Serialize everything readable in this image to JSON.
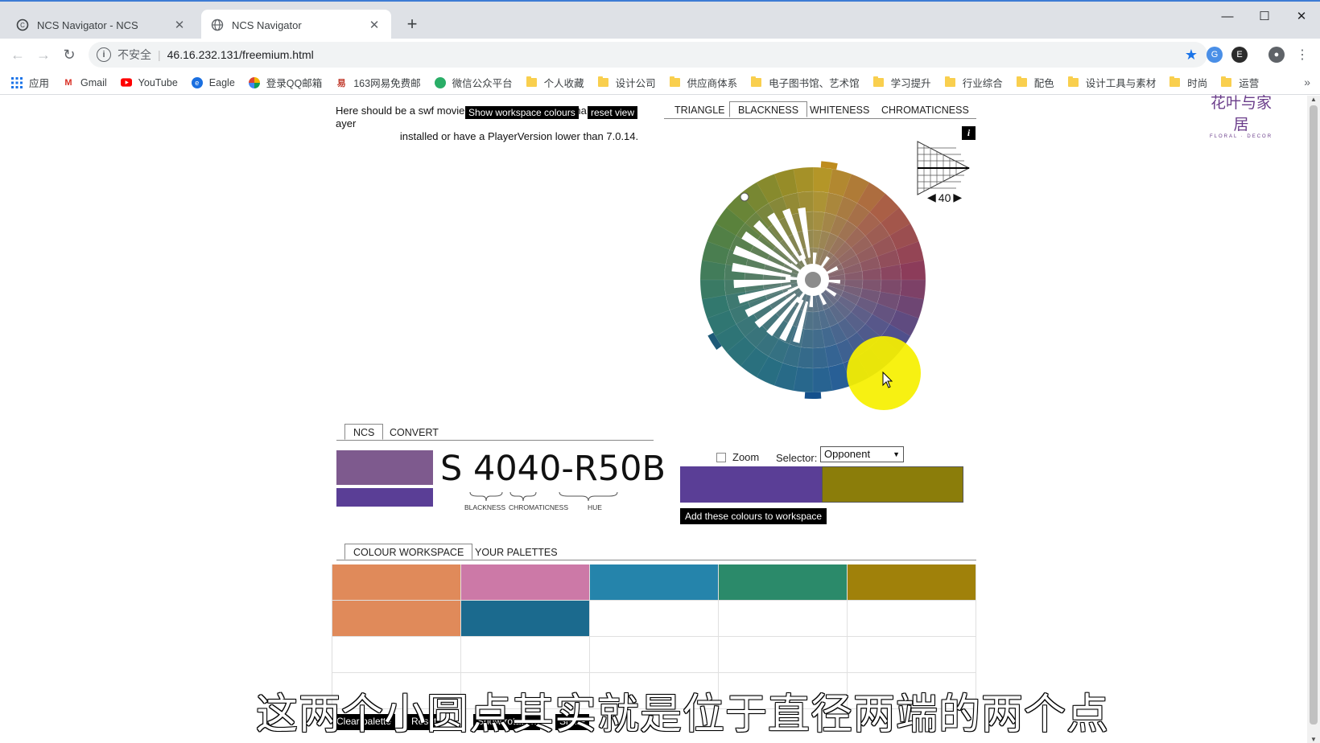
{
  "browser": {
    "tabs": [
      {
        "title": "NCS Navigator - NCS",
        "active": false
      },
      {
        "title": "NCS Navigator",
        "active": true
      }
    ],
    "new_tab": "+",
    "window_controls": {
      "minimize": "—",
      "maximize": "☐",
      "close": "✕"
    },
    "address": {
      "security_label": "不安全",
      "separator": "|",
      "url": "46.16.232.131/freemium.html"
    },
    "bookmarks": [
      {
        "label": "应用",
        "icon": "apps-grid-icon"
      },
      {
        "label": "Gmail",
        "icon": "gmail-icon"
      },
      {
        "label": "YouTube",
        "icon": "youtube-icon"
      },
      {
        "label": "Eagle",
        "icon": "eagle-icon"
      },
      {
        "label": "登录QQ邮箱",
        "icon": "qq-mail-icon"
      },
      {
        "label": "163网易免费邮",
        "icon": "netease-icon"
      },
      {
        "label": "微信公众平台",
        "icon": "wechat-icon"
      },
      {
        "label": "个人收藏",
        "icon": "folder-icon"
      },
      {
        "label": "设计公司",
        "icon": "folder-icon"
      },
      {
        "label": "供应商体系",
        "icon": "folder-icon"
      },
      {
        "label": "电子图书馆、艺术馆",
        "icon": "folder-icon"
      },
      {
        "label": "学习提升",
        "icon": "folder-icon"
      },
      {
        "label": "行业综合",
        "icon": "folder-icon"
      },
      {
        "label": "配色",
        "icon": "folder-icon"
      },
      {
        "label": "设计工具与素材",
        "icon": "folder-icon"
      },
      {
        "label": "时尚",
        "icon": "folder-icon"
      },
      {
        "label": "运营",
        "icon": "folder-icon"
      }
    ],
    "bookmarks_overflow": "»"
  },
  "page": {
    "swf_message_line1": "Here should be a swf movie",
    "swf_message_tail1": "ha",
    "swf_message_tail2": "ayer",
    "swf_message_line2": "installed or have a PlayerVersion lower than 7.0.14.",
    "show_workspace_colours": "Show workspace colours",
    "reset_view": "reset view",
    "view_tabs": [
      "TRIANGLE",
      "BLACKNESS",
      "WHITENESS",
      "CHROMATICNESS"
    ],
    "active_view_tab": "BLACKNESS",
    "info_button": "i",
    "level_value": "40",
    "level_prev": "◀",
    "level_next": "▶",
    "logo_cn": "花叶与家居",
    "logo_en": "FLORAL · DECOR",
    "ncs_tabs": [
      "NCS",
      "CONVERT"
    ],
    "ncs_code": "S 4040-R50B",
    "ncs_labels": {
      "blackness": "BLACKNESS",
      "chromaticness": "CHROMATICNESS",
      "hue": "HUE"
    },
    "swatch_top_color": "#7e5a8e",
    "swatch_bottom_color": "#5a3e96",
    "zoom_label": "Zoom",
    "selector_label": "Selector:",
    "selector_value": "Opponent",
    "pair_colors": [
      "#5a3e96",
      "#8b7d0a"
    ],
    "add_colours_button": "Add these colours to workspace",
    "workspace_tabs": [
      "COLOUR WORKSPACE",
      "YOUR PALETTES"
    ],
    "workspace_cells": [
      [
        "#e08a5a",
        "#cc79a7",
        "#2584ab",
        "#2b8a6a",
        "#a0810a"
      ],
      [
        "#e08a5a",
        "#1b6a8e",
        "#ffffff",
        "#ffffff",
        "#ffffff"
      ],
      [
        "#ffffff",
        "#ffffff",
        "#ffffff",
        "#ffffff",
        "#ffffff"
      ],
      [
        "#ffffff",
        "#ffffff",
        "#ffffff",
        "#ffffff",
        "#ffffff"
      ]
    ],
    "bottom_buttons": [
      "Clear palette",
      "Reset",
      "Show rotation",
      "Share"
    ],
    "subtitle": "这两个小圆点其实就是位于直径两端的两个点"
  }
}
